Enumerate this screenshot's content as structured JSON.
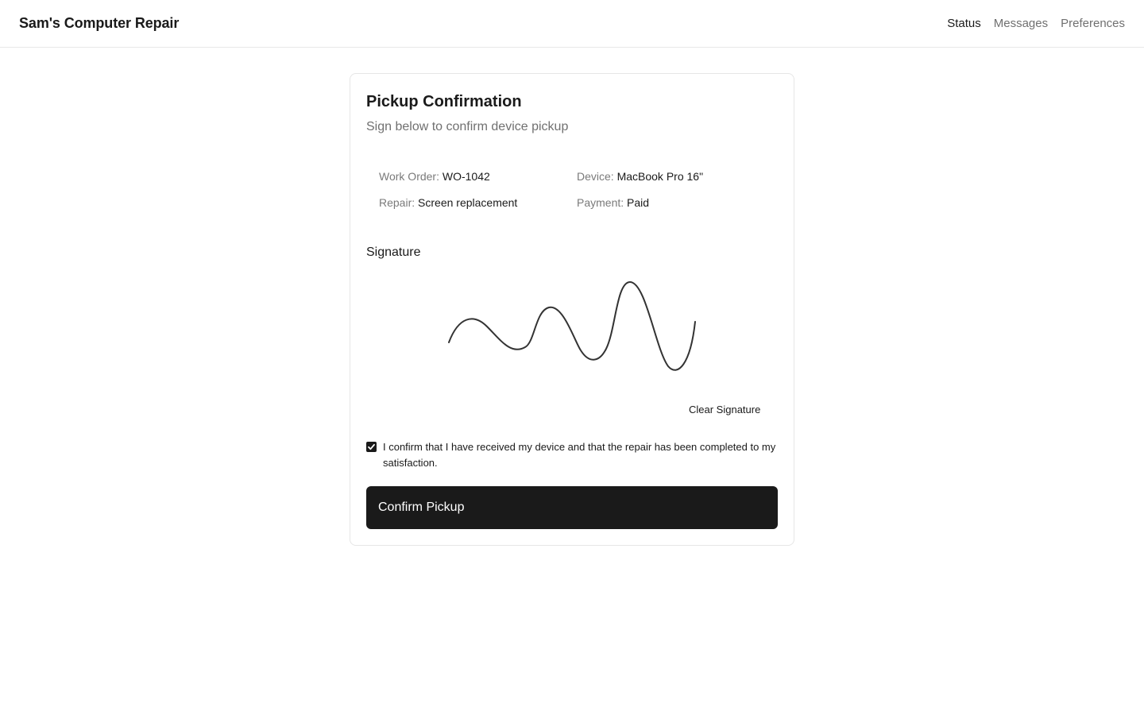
{
  "header": {
    "brand": "Sam's Computer Repair",
    "nav": [
      {
        "label": "Status",
        "active": true
      },
      {
        "label": "Messages",
        "active": false
      },
      {
        "label": "Preferences",
        "active": false
      }
    ]
  },
  "card": {
    "title": "Pickup Confirmation",
    "subtitle": "Sign below to confirm device pickup",
    "info": {
      "work_order": {
        "label": "Work Order:",
        "value": "WO-1042"
      },
      "device": {
        "label": "Device:",
        "value": "MacBook Pro 16\""
      },
      "repair": {
        "label": "Repair:",
        "value": "Screen replacement"
      },
      "payment": {
        "label": "Payment:",
        "value": "Paid"
      }
    },
    "signature": {
      "label": "Signature",
      "clear_label": "Clear Signature"
    },
    "confirmation": {
      "checked": true,
      "text": "I confirm that I have received my device and that the repair has been completed to my satisfaction."
    },
    "submit_label": "Confirm Pickup"
  },
  "colors": {
    "text": "#1a1a1a",
    "muted": "#707070",
    "button_bg": "#1a1a1a",
    "border": "#e6e6e6"
  }
}
